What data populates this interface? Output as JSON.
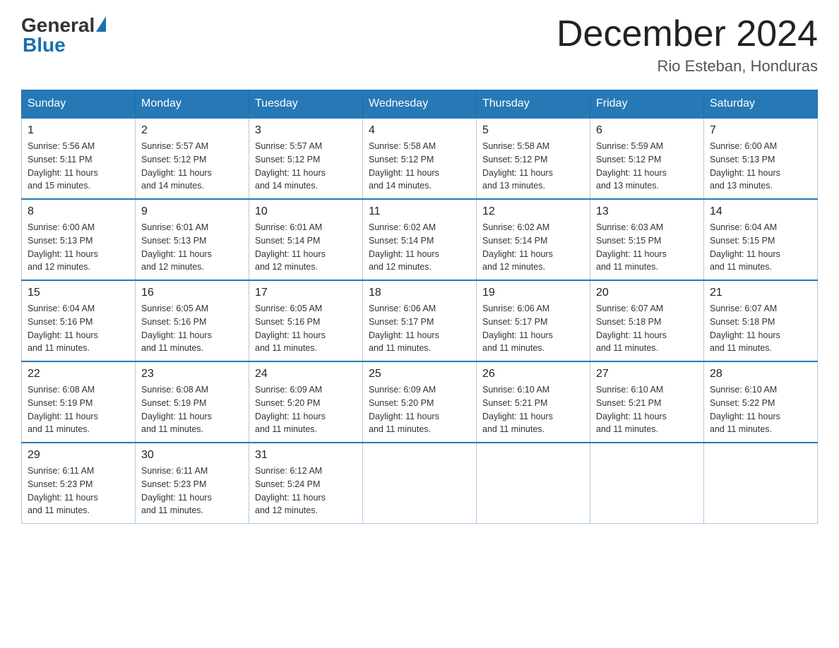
{
  "header": {
    "logo_general": "General",
    "logo_blue": "Blue",
    "month_title": "December 2024",
    "location": "Rio Esteban, Honduras"
  },
  "days_of_week": [
    "Sunday",
    "Monday",
    "Tuesday",
    "Wednesday",
    "Thursday",
    "Friday",
    "Saturday"
  ],
  "weeks": [
    [
      {
        "day": "1",
        "sunrise": "5:56 AM",
        "sunset": "5:11 PM",
        "daylight": "11 hours and 15 minutes."
      },
      {
        "day": "2",
        "sunrise": "5:57 AM",
        "sunset": "5:12 PM",
        "daylight": "11 hours and 14 minutes."
      },
      {
        "day": "3",
        "sunrise": "5:57 AM",
        "sunset": "5:12 PM",
        "daylight": "11 hours and 14 minutes."
      },
      {
        "day": "4",
        "sunrise": "5:58 AM",
        "sunset": "5:12 PM",
        "daylight": "11 hours and 14 minutes."
      },
      {
        "day": "5",
        "sunrise": "5:58 AM",
        "sunset": "5:12 PM",
        "daylight": "11 hours and 13 minutes."
      },
      {
        "day": "6",
        "sunrise": "5:59 AM",
        "sunset": "5:12 PM",
        "daylight": "11 hours and 13 minutes."
      },
      {
        "day": "7",
        "sunrise": "6:00 AM",
        "sunset": "5:13 PM",
        "daylight": "11 hours and 13 minutes."
      }
    ],
    [
      {
        "day": "8",
        "sunrise": "6:00 AM",
        "sunset": "5:13 PM",
        "daylight": "11 hours and 12 minutes."
      },
      {
        "day": "9",
        "sunrise": "6:01 AM",
        "sunset": "5:13 PM",
        "daylight": "11 hours and 12 minutes."
      },
      {
        "day": "10",
        "sunrise": "6:01 AM",
        "sunset": "5:14 PM",
        "daylight": "11 hours and 12 minutes."
      },
      {
        "day": "11",
        "sunrise": "6:02 AM",
        "sunset": "5:14 PM",
        "daylight": "11 hours and 12 minutes."
      },
      {
        "day": "12",
        "sunrise": "6:02 AM",
        "sunset": "5:14 PM",
        "daylight": "11 hours and 12 minutes."
      },
      {
        "day": "13",
        "sunrise": "6:03 AM",
        "sunset": "5:15 PM",
        "daylight": "11 hours and 11 minutes."
      },
      {
        "day": "14",
        "sunrise": "6:04 AM",
        "sunset": "5:15 PM",
        "daylight": "11 hours and 11 minutes."
      }
    ],
    [
      {
        "day": "15",
        "sunrise": "6:04 AM",
        "sunset": "5:16 PM",
        "daylight": "11 hours and 11 minutes."
      },
      {
        "day": "16",
        "sunrise": "6:05 AM",
        "sunset": "5:16 PM",
        "daylight": "11 hours and 11 minutes."
      },
      {
        "day": "17",
        "sunrise": "6:05 AM",
        "sunset": "5:16 PM",
        "daylight": "11 hours and 11 minutes."
      },
      {
        "day": "18",
        "sunrise": "6:06 AM",
        "sunset": "5:17 PM",
        "daylight": "11 hours and 11 minutes."
      },
      {
        "day": "19",
        "sunrise": "6:06 AM",
        "sunset": "5:17 PM",
        "daylight": "11 hours and 11 minutes."
      },
      {
        "day": "20",
        "sunrise": "6:07 AM",
        "sunset": "5:18 PM",
        "daylight": "11 hours and 11 minutes."
      },
      {
        "day": "21",
        "sunrise": "6:07 AM",
        "sunset": "5:18 PM",
        "daylight": "11 hours and 11 minutes."
      }
    ],
    [
      {
        "day": "22",
        "sunrise": "6:08 AM",
        "sunset": "5:19 PM",
        "daylight": "11 hours and 11 minutes."
      },
      {
        "day": "23",
        "sunrise": "6:08 AM",
        "sunset": "5:19 PM",
        "daylight": "11 hours and 11 minutes."
      },
      {
        "day": "24",
        "sunrise": "6:09 AM",
        "sunset": "5:20 PM",
        "daylight": "11 hours and 11 minutes."
      },
      {
        "day": "25",
        "sunrise": "6:09 AM",
        "sunset": "5:20 PM",
        "daylight": "11 hours and 11 minutes."
      },
      {
        "day": "26",
        "sunrise": "6:10 AM",
        "sunset": "5:21 PM",
        "daylight": "11 hours and 11 minutes."
      },
      {
        "day": "27",
        "sunrise": "6:10 AM",
        "sunset": "5:21 PM",
        "daylight": "11 hours and 11 minutes."
      },
      {
        "day": "28",
        "sunrise": "6:10 AM",
        "sunset": "5:22 PM",
        "daylight": "11 hours and 11 minutes."
      }
    ],
    [
      {
        "day": "29",
        "sunrise": "6:11 AM",
        "sunset": "5:23 PM",
        "daylight": "11 hours and 11 minutes."
      },
      {
        "day": "30",
        "sunrise": "6:11 AM",
        "sunset": "5:23 PM",
        "daylight": "11 hours and 11 minutes."
      },
      {
        "day": "31",
        "sunrise": "6:12 AM",
        "sunset": "5:24 PM",
        "daylight": "11 hours and 12 minutes."
      },
      null,
      null,
      null,
      null
    ]
  ],
  "labels": {
    "sunrise": "Sunrise:",
    "sunset": "Sunset:",
    "daylight": "Daylight:"
  }
}
